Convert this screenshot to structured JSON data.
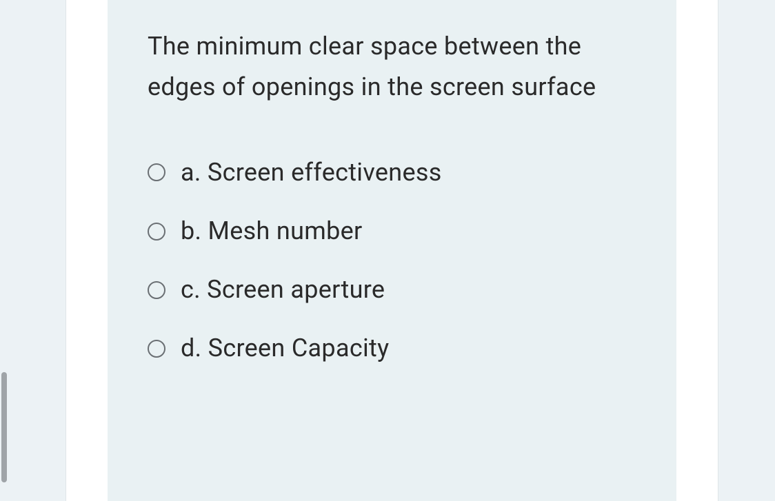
{
  "question": {
    "text": "The minimum clear space between the edges of openings in the screen surface"
  },
  "options": [
    {
      "letter": "a.",
      "text": "Screen effectiveness"
    },
    {
      "letter": "b.",
      "text": "Mesh number"
    },
    {
      "letter": "c.",
      "text": "Screen aperture"
    },
    {
      "letter": "d.",
      "text": "Screen Capacity"
    }
  ]
}
